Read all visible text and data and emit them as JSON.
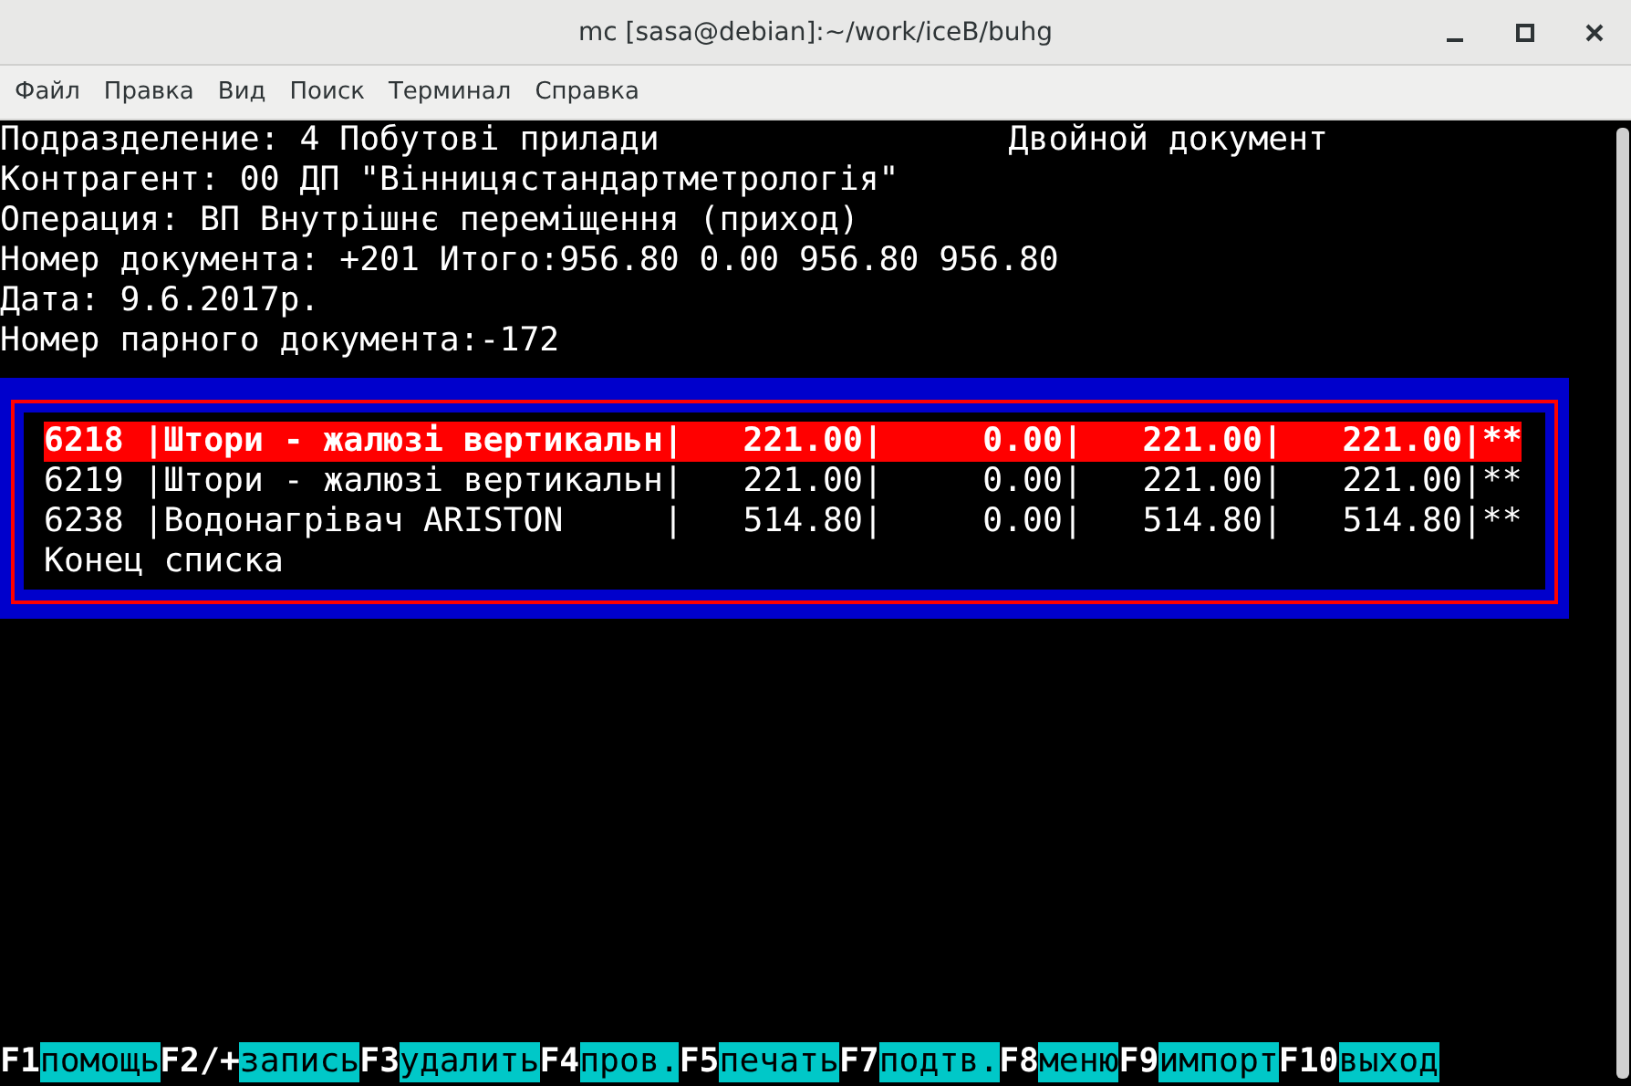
{
  "window": {
    "title": "mc [sasa@debian]:~/work/iceB/buhg"
  },
  "menu": [
    "Файл",
    "Правка",
    "Вид",
    "Поиск",
    "Терминал",
    "Справка"
  ],
  "header_lines": [
    {
      "left": "Подразделение: 4 Побутові прилади",
      "right": "Двойной документ"
    },
    {
      "left": "Контрагент: 00 ДП \"Вінницястандартметрологія\""
    },
    {
      "left": "Операция: ВП Внутрішнє переміщення (приход)"
    },
    {
      "left": "Номер документа: +201 Итого:956.80 0.00 956.80 956.80"
    },
    {
      "left": "Дата: 9.6.2017р."
    },
    {
      "left": "Номер парного документа:-172"
    }
  ],
  "rows": [
    {
      "text": "6218 |Штори - жалюзі вертикальн|   221.00|     0.00|   221.00|   221.00|**",
      "selected": true
    },
    {
      "text": "6219 |Штори - жалюзі вертикальн|   221.00|     0.00|   221.00|   221.00|**",
      "selected": false
    },
    {
      "text": "6238 |Водонагрівач ARISTON     |   514.80|     0.00|   514.80|   514.80|**",
      "selected": false
    }
  ],
  "list_end": "Конец списка",
  "function_keys": [
    {
      "key": "F1",
      "label": "помощь"
    },
    {
      "key": "F2/+",
      "label": "запись"
    },
    {
      "key": "F3",
      "label": "удалить"
    },
    {
      "key": "F4",
      "label": "пров."
    },
    {
      "key": "F5",
      "label": "печать"
    },
    {
      "key": "F7",
      "label": "подтв."
    },
    {
      "key": "F8",
      "label": "меню"
    },
    {
      "key": "F9",
      "label": "импорт"
    },
    {
      "key": "F10",
      "label": "выход"
    }
  ]
}
